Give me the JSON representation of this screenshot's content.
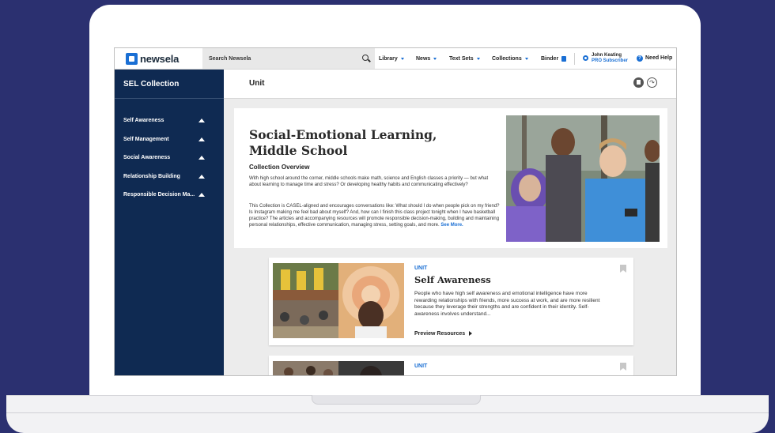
{
  "topbar": {
    "logo": "newsela",
    "search_placeholder": "Search Newsela",
    "nav": [
      {
        "label": "Library",
        "has_caret": true
      },
      {
        "label": "News",
        "has_caret": true
      },
      {
        "label": "Text Sets",
        "has_caret": true
      },
      {
        "label": "Collections",
        "has_caret": true
      },
      {
        "label": "Binder",
        "has_caret": false
      }
    ],
    "user_name": "John Keating",
    "user_plan": "PRO Subscriber",
    "help": "Need Help"
  },
  "sidebar": {
    "title": "SEL Collection",
    "items": [
      {
        "label": "Self Awareness"
      },
      {
        "label": "Self Management"
      },
      {
        "label": "Social Awareness"
      },
      {
        "label": "Relationship Building"
      },
      {
        "label": "Responsible Decision Ma..."
      }
    ]
  },
  "header": {
    "title": "Unit"
  },
  "hero": {
    "title": "Social-Emotional Learning, Middle School",
    "subtitle": "Collection Overview",
    "paragraph1": "With high school around the corner, middle schools make math, science and English classes a priority — but what about learning to manage time and stress? Or developing healthy habits and communicating effectively?",
    "paragraph2": "This Collection is CASEL-aligned and encourages conversations like: What should I do when people pick on my friend? Is Instagram making me feel bad about myself? And, how can I finish this class project tonight when I have basketball practice? The articles and accompanying resources will promote responsible decision-making, building and maintaining personal relationships, effective communication, managing stress, setting goals, and more.",
    "see_more": "See More."
  },
  "cards": [
    {
      "tag": "UNIT",
      "title": "Self Awareness",
      "description": "People who have high self awareness and emotional intelligence have more rewarding relationships with friends, more success at work, and are more resilient because they leverage their strengths and are confident in their identity. Self-awareness involves understand...",
      "link": "Preview Resources"
    },
    {
      "tag": "UNIT",
      "title": "",
      "description": "",
      "link": ""
    }
  ],
  "colors": {
    "background": "#2b3070",
    "sidebar": "#0f2a52",
    "accent": "#1a6fd4"
  }
}
